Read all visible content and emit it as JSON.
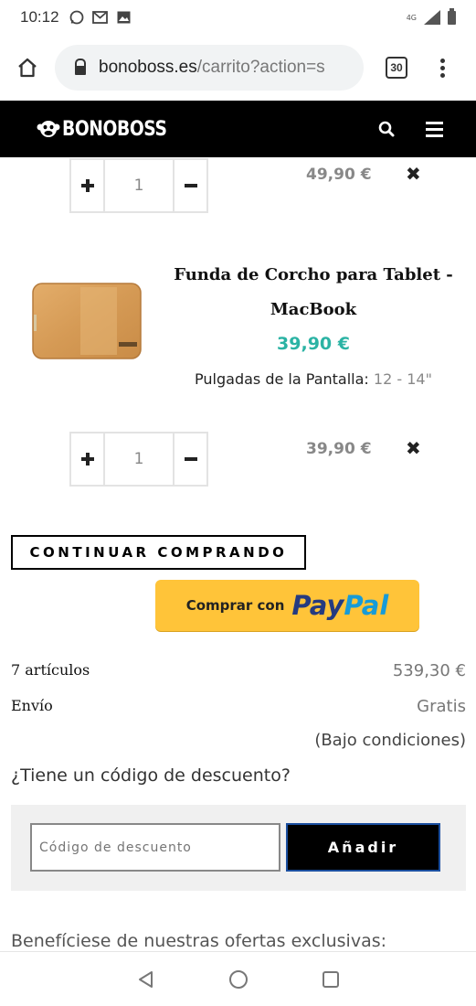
{
  "status_bar": {
    "time": "10:12",
    "network": "4G",
    "icons": [
      "whatsapp-icon",
      "gmail-icon",
      "image-icon"
    ]
  },
  "browser": {
    "url_host": "bonoboss.es",
    "url_path": "/carrito?action=s",
    "tab_count": "30"
  },
  "site": {
    "logo_text": "BONOBOSS"
  },
  "cart": {
    "items": [
      {
        "quantity": "1",
        "line_total": "49,90 €"
      },
      {
        "name": "Funda de Corcho para Tablet - MacBook",
        "unit_price": "39,90 €",
        "attribute_label": "Pulgadas de la Pantalla:",
        "attribute_value": "12 - 14\"",
        "quantity": "1",
        "line_total": "39,90 €"
      }
    ],
    "remove_symbol": "✖",
    "continue_label": "CONTINUAR COMPRANDO",
    "paypal": {
      "prefix": "Comprar con",
      "pay": "Pay",
      "pal": "Pal"
    },
    "summary": {
      "items_label": "7 artículos",
      "items_value": "539,30 €",
      "shipping_label": "Envío",
      "shipping_value": "Gratis",
      "shipping_note": "(Bajo condiciones)"
    },
    "discount": {
      "question": "¿Tiene un código de descuento?",
      "placeholder": "Código de descuento",
      "add_label": "Añadir"
    },
    "offers_text": "Benefíciese de nuestras ofertas exclusivas:"
  },
  "colors": {
    "price_accent": "#2bb3a4",
    "header_bg": "#000000",
    "paypal_yellow": "#ffc439"
  }
}
